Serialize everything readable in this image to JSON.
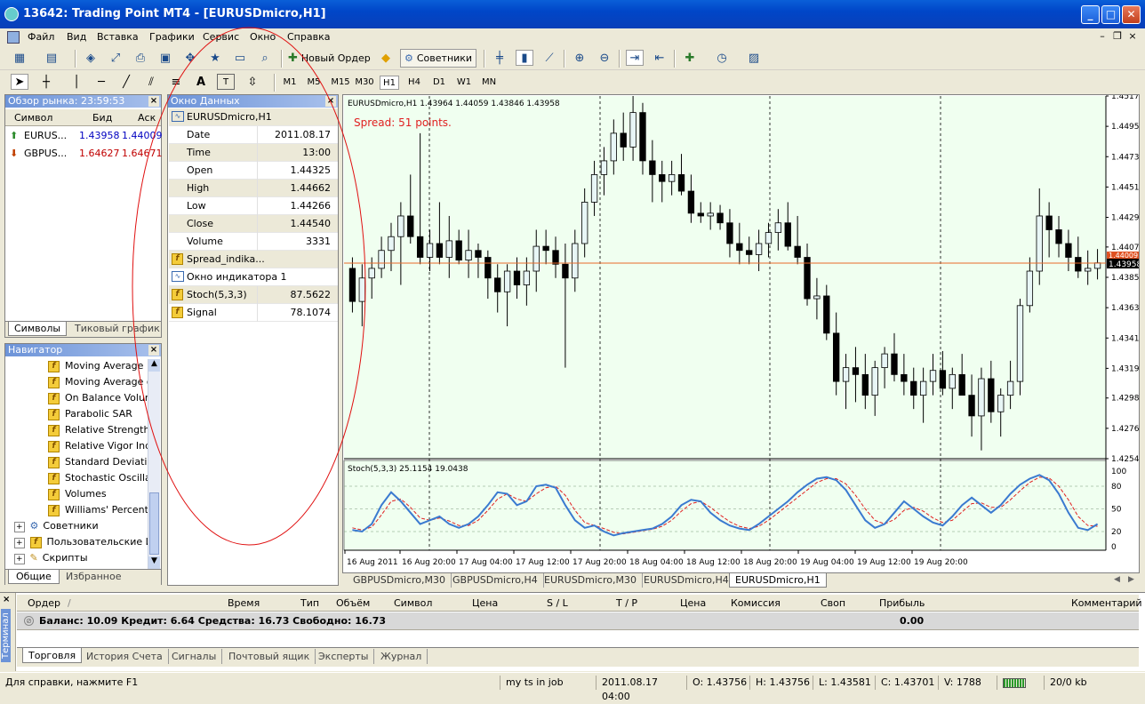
{
  "window": {
    "title": "13642: Trading Point MT4 - [EURUSDmicro,H1]"
  },
  "menu": [
    "Файл",
    "Вид",
    "Вставка",
    "Графики",
    "Сервис",
    "Окно",
    "Справка"
  ],
  "toolbar": {
    "new_order": "Новый Ордер",
    "experts": "Советники"
  },
  "timeframes": [
    "M1",
    "M5",
    "M15",
    "M30",
    "H1",
    "H4",
    "D1",
    "W1",
    "MN"
  ],
  "active_timeframe": "H1",
  "tool_labels": {
    "text": "A",
    "label": "T"
  },
  "market_watch": {
    "title": "Обзор рынка: 23:59:53",
    "headers": {
      "symbol": "Символ",
      "bid": "Бид",
      "ask": "Аск"
    },
    "rows": [
      {
        "symbol": "EURUS...",
        "bid": "1.43958",
        "ask": "1.44009",
        "color": "#0000c0"
      },
      {
        "symbol": "GBPUS...",
        "bid": "1.64627",
        "ask": "1.64671",
        "color": "#c00000"
      }
    ],
    "tabs": [
      "Символы",
      "Тиковый график"
    ]
  },
  "navigator": {
    "title": "Навигатор",
    "indicators": [
      "Moving Average",
      "Moving Average o",
      "On Balance Volume",
      "Parabolic SAR",
      "Relative Strength",
      "Relative Vigor Inde",
      "Standard Deviatio",
      "Stochastic Oscillat",
      "Volumes",
      "Williams' Percent R"
    ],
    "folders": [
      "Советники",
      "Пользовательские И",
      "Скрипты"
    ],
    "tabs": [
      "Общие",
      "Избранное"
    ]
  },
  "data_window": {
    "title": "Окно Данных",
    "symbol": "EURUSDmicro,H1",
    "rows": [
      {
        "k": "Date",
        "v": "2011.08.17"
      },
      {
        "k": "Time",
        "v": "13:00"
      },
      {
        "k": "Open",
        "v": "1.44325"
      },
      {
        "k": "High",
        "v": "1.44662"
      },
      {
        "k": "Low",
        "v": "1.44266"
      },
      {
        "k": "Close",
        "v": "1.44540"
      },
      {
        "k": "Volume",
        "v": "3331"
      }
    ],
    "spread_ind": "Spread_indika...",
    "sub_window": "Окно индикатора 1",
    "stoch": {
      "k": "Stoch(5,3,3)",
      "v": "87.5622"
    },
    "signal": {
      "k": "Signal",
      "v": "78.1074"
    }
  },
  "chart": {
    "header": "EURUSDmicro,H1  1.43964 1.44059 1.43846 1.43958",
    "spread_text": "Spread: 51 points.",
    "price_labels": [
      "1.45170",
      "1.44950",
      "1.44730",
      "1.44510",
      "1.44290",
      "1.44075",
      "1.43855",
      "1.43635",
      "1.43415",
      "1.43195",
      "1.42980",
      "1.42760",
      "1.42540"
    ],
    "current_price_box": "1.43958",
    "ask_box": "1.44009",
    "stoch_header": "Stoch(5,3,3) 25.1154 19.0438",
    "stoch_levels": [
      "100",
      "80",
      "50",
      "20",
      "0"
    ],
    "time_labels": [
      "16 Aug 2011",
      "16 Aug 20:00",
      "17 Aug 04:00",
      "17 Aug 12:00",
      "17 Aug 20:00",
      "18 Aug 04:00",
      "18 Aug 12:00",
      "18 Aug 20:00",
      "19 Aug 04:00",
      "19 Aug 12:00",
      "19 Aug 20:00"
    ],
    "colors": {
      "bg": "#f0fff0",
      "price_line": "#e86a2a",
      "stoch_main": "#3a7ad0",
      "stoch_signal": "#e02020"
    }
  },
  "chart_data": {
    "type": "candlestick",
    "symbol": "EURUSDmicro",
    "timeframe": "H1",
    "ylim": [
      1.4254,
      1.4517
    ],
    "current_price": 1.43958,
    "ohlc": [
      [
        1.4392,
        1.44,
        1.436,
        1.4368
      ],
      [
        1.4368,
        1.4395,
        1.435,
        1.4385
      ],
      [
        1.4385,
        1.44,
        1.437,
        1.4392
      ],
      [
        1.4392,
        1.4415,
        1.4385,
        1.4405
      ],
      [
        1.4405,
        1.4425,
        1.439,
        1.4415
      ],
      [
        1.4415,
        1.444,
        1.438,
        1.443
      ],
      [
        1.443,
        1.446,
        1.441,
        1.4415
      ],
      [
        1.4415,
        1.449,
        1.4395,
        1.44
      ],
      [
        1.44,
        1.442,
        1.439,
        1.441
      ],
      [
        1.441,
        1.444,
        1.4395,
        1.44
      ],
      [
        1.44,
        1.443,
        1.4385,
        1.4412
      ],
      [
        1.4412,
        1.442,
        1.4395,
        1.4398
      ],
      [
        1.4398,
        1.442,
        1.4385,
        1.4405
      ],
      [
        1.4405,
        1.441,
        1.4385,
        1.44
      ],
      [
        1.44,
        1.4405,
        1.437,
        1.4385
      ],
      [
        1.4385,
        1.4395,
        1.436,
        1.4375
      ],
      [
        1.4375,
        1.4395,
        1.435,
        1.439
      ],
      [
        1.439,
        1.44,
        1.437,
        1.438
      ],
      [
        1.438,
        1.44,
        1.4365,
        1.439
      ],
      [
        1.439,
        1.442,
        1.4375,
        1.4408
      ],
      [
        1.4408,
        1.442,
        1.4395,
        1.4405
      ],
      [
        1.4405,
        1.4415,
        1.4385,
        1.4395
      ],
      [
        1.4395,
        1.441,
        1.432,
        1.4385
      ],
      [
        1.4385,
        1.442,
        1.4375,
        1.441
      ],
      [
        1.441,
        1.445,
        1.44,
        1.444
      ],
      [
        1.444,
        1.447,
        1.443,
        1.446
      ],
      [
        1.446,
        1.448,
        1.4445,
        1.447
      ],
      [
        1.447,
        1.45,
        1.446,
        1.449
      ],
      [
        1.449,
        1.4505,
        1.447,
        1.448
      ],
      [
        1.448,
        1.4517,
        1.447,
        1.4505
      ],
      [
        1.4505,
        1.4512,
        1.446,
        1.447
      ],
      [
        1.447,
        1.4485,
        1.444,
        1.446
      ],
      [
        1.446,
        1.447,
        1.444,
        1.4455
      ],
      [
        1.4455,
        1.447,
        1.4445,
        1.446
      ],
      [
        1.446,
        1.4475,
        1.4445,
        1.4448
      ],
      [
        1.4448,
        1.446,
        1.4425,
        1.4432
      ],
      [
        1.4432,
        1.444,
        1.4425,
        1.443
      ],
      [
        1.443,
        1.444,
        1.442,
        1.4432
      ],
      [
        1.4432,
        1.4438,
        1.442,
        1.4425
      ],
      [
        1.4425,
        1.4435,
        1.44,
        1.441
      ],
      [
        1.441,
        1.4425,
        1.4395,
        1.4405
      ],
      [
        1.4405,
        1.4415,
        1.4395,
        1.4402
      ],
      [
        1.4402,
        1.442,
        1.439,
        1.441
      ],
      [
        1.441,
        1.4425,
        1.44,
        1.4418
      ],
      [
        1.4418,
        1.4435,
        1.4405,
        1.4425
      ],
      [
        1.4425,
        1.444,
        1.4405,
        1.4408
      ],
      [
        1.4408,
        1.443,
        1.4395,
        1.44
      ],
      [
        1.44,
        1.441,
        1.4365,
        1.437
      ],
      [
        1.437,
        1.4385,
        1.4355,
        1.4372
      ],
      [
        1.4372,
        1.438,
        1.434,
        1.4345
      ],
      [
        1.4345,
        1.436,
        1.43,
        1.431
      ],
      [
        1.431,
        1.433,
        1.429,
        1.432
      ],
      [
        1.432,
        1.4335,
        1.4295,
        1.4315
      ],
      [
        1.4315,
        1.433,
        1.429,
        1.43
      ],
      [
        1.43,
        1.4325,
        1.4285,
        1.432
      ],
      [
        1.432,
        1.4335,
        1.4305,
        1.433
      ],
      [
        1.433,
        1.4345,
        1.431,
        1.4315
      ],
      [
        1.4315,
        1.433,
        1.43,
        1.431
      ],
      [
        1.431,
        1.432,
        1.429,
        1.43
      ],
      [
        1.43,
        1.432,
        1.428,
        1.431
      ],
      [
        1.431,
        1.433,
        1.43,
        1.4318
      ],
      [
        1.4318,
        1.4332,
        1.43,
        1.4305
      ],
      [
        1.4305,
        1.432,
        1.429,
        1.4315
      ],
      [
        1.4315,
        1.433,
        1.43,
        1.43
      ],
      [
        1.43,
        1.4315,
        1.427,
        1.4285
      ],
      [
        1.4285,
        1.432,
        1.426,
        1.4312
      ],
      [
        1.4312,
        1.4325,
        1.428,
        1.4288
      ],
      [
        1.4288,
        1.4305,
        1.427,
        1.43
      ],
      [
        1.43,
        1.4325,
        1.429,
        1.431
      ],
      [
        1.431,
        1.437,
        1.43,
        1.4365
      ],
      [
        1.4365,
        1.44,
        1.436,
        1.439
      ],
      [
        1.439,
        1.445,
        1.438,
        1.443
      ],
      [
        1.443,
        1.444,
        1.44,
        1.442
      ],
      [
        1.442,
        1.443,
        1.44,
        1.441
      ],
      [
        1.441,
        1.442,
        1.439,
        1.44
      ],
      [
        1.44,
        1.4415,
        1.4385,
        1.439
      ],
      [
        1.439,
        1.4405,
        1.438,
        1.4392
      ],
      [
        1.4392,
        1.4406,
        1.4384,
        1.4396
      ]
    ],
    "stochastic": {
      "main": [
        22,
        20,
        30,
        55,
        72,
        60,
        45,
        30,
        35,
        40,
        30,
        25,
        30,
        40,
        55,
        72,
        70,
        55,
        60,
        80,
        82,
        78,
        55,
        35,
        25,
        28,
        20,
        15,
        18,
        20,
        22,
        24,
        30,
        40,
        55,
        62,
        60,
        45,
        35,
        28,
        24,
        22,
        30,
        40,
        50,
        60,
        72,
        82,
        90,
        92,
        88,
        75,
        55,
        35,
        25,
        30,
        45,
        60,
        50,
        40,
        32,
        28,
        40,
        55,
        65,
        55,
        45,
        55,
        70,
        82,
        90,
        95,
        88,
        70,
        45,
        25,
        22,
        30
      ],
      "signal": [
        25,
        22,
        26,
        42,
        60,
        63,
        52,
        38,
        35,
        38,
        34,
        28,
        28,
        35,
        48,
        63,
        70,
        63,
        60,
        70,
        78,
        80,
        68,
        48,
        32,
        28,
        24,
        19,
        17,
        19,
        21,
        23,
        27,
        35,
        47,
        57,
        60,
        52,
        42,
        33,
        27,
        24,
        27,
        35,
        45,
        55,
        65,
        75,
        85,
        90,
        90,
        83,
        68,
        50,
        35,
        30,
        36,
        48,
        52,
        47,
        38,
        32,
        35,
        46,
        57,
        58,
        52,
        52,
        62,
        74,
        85,
        92,
        91,
        80,
        62,
        40,
        28,
        27
      ],
      "levels": [
        20,
        50,
        80
      ]
    },
    "xlabels": [
      "16 Aug 2011",
      "16 Aug 20:00",
      "17 Aug 04:00",
      "17 Aug 12:00",
      "17 Aug 20:00",
      "18 Aug 04:00",
      "18 Aug 12:00",
      "18 Aug 20:00",
      "19 Aug 04:00",
      "19 Aug 12:00",
      "19 Aug 20:00"
    ]
  },
  "chart_tabs": [
    "GBPUSDmicro,M30",
    "GBPUSDmicro,H4",
    "EURUSDmicro,M30",
    "EURUSDmicro,H4",
    "EURUSDmicro,H1"
  ],
  "terminal": {
    "side_label": "Терминал",
    "headers": [
      "Ордер",
      "Время",
      "Тип",
      "Объём",
      "Символ",
      "Цена",
      "S / L",
      "T / P",
      "Цена",
      "Комиссия",
      "Своп",
      "Прибыль",
      "Комментарий"
    ],
    "balance_text": "Баланс: 10.09  Кредит: 6.64  Средства: 16.73  Свободно: 16.73",
    "profit": "0.00",
    "tabs": [
      "Торговля",
      "История Счета",
      "Сигналы",
      "Почтовый ящик",
      "Эксперты",
      "Журнал"
    ]
  },
  "status": {
    "help": "Для справки, нажмите F1",
    "profile": "my ts in job",
    "datetime": "2011.08.17 04:00",
    "o": "O: 1.43756",
    "h": "H: 1.43756",
    "l": "L: 1.43581",
    "c": "C: 1.43701",
    "v": "V: 1788",
    "traffic": "20/0 kb"
  }
}
